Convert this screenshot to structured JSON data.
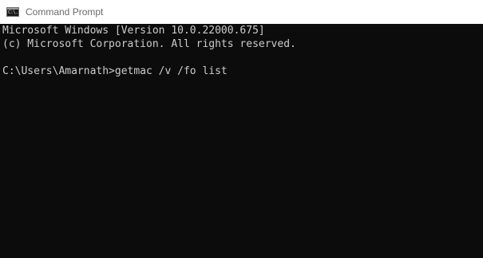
{
  "window": {
    "title": "Command Prompt",
    "icon": "cmd-icon",
    "icon_text": "C:\\."
  },
  "console": {
    "lines": [
      "Microsoft Windows [Version 10.0.22000.675]",
      "(c) Microsoft Corporation. All rights reserved.",
      "",
      "C:\\Users\\Amarnath>getmac /v /fo list"
    ]
  },
  "colors": {
    "titlebar_bg": "#ffffff",
    "title_text": "#6a6a6a",
    "console_bg": "#0c0c0c",
    "console_text": "#cccccc"
  }
}
